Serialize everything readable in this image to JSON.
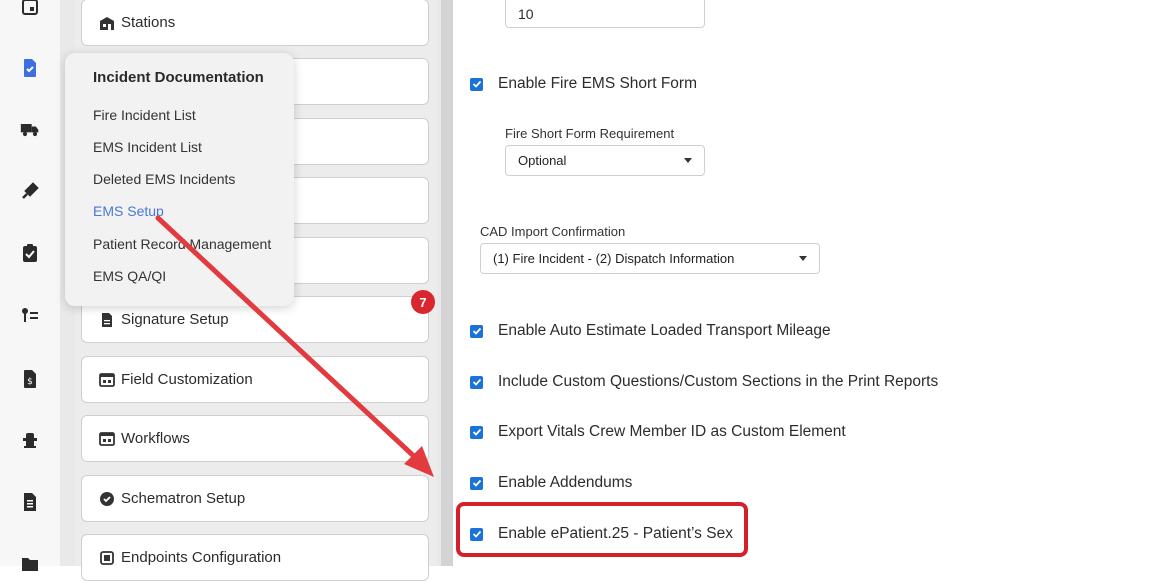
{
  "rail": {
    "icons": [
      "calendar-icon",
      "document-check-icon",
      "truck-icon",
      "syringe-icon",
      "clipboard-check-icon",
      "key-list-icon",
      "invoice-icon",
      "hydrant-icon",
      "report-icon",
      "folder-icon"
    ]
  },
  "settings_list": {
    "items": [
      {
        "label": "Stations",
        "icon": "building-icon"
      },
      {
        "label": "Signature Setup",
        "icon": "file-icon"
      },
      {
        "label": "Field Customization",
        "icon": "form-icon"
      },
      {
        "label": "Workflows",
        "icon": "form-icon"
      },
      {
        "label": "Schematron Setup",
        "icon": "badge-check-icon"
      },
      {
        "label": "Endpoints Configuration",
        "icon": "endpoint-icon"
      }
    ],
    "badge_count": "7"
  },
  "popup": {
    "title": "Incident Documentation",
    "items": [
      {
        "label": "Fire Incident List"
      },
      {
        "label": "EMS Incident List"
      },
      {
        "label": "Deleted EMS Incidents"
      },
      {
        "label": "EMS Setup",
        "active": true
      },
      {
        "label": "Patient Record Management"
      },
      {
        "label": "EMS QA/QI"
      }
    ]
  },
  "main": {
    "top_input_value": "10",
    "checkboxes": [
      {
        "label": "Enable Fire EMS Short Form",
        "checked": true
      },
      {
        "label": "Enable Auto Estimate Loaded Transport Mileage",
        "checked": true
      },
      {
        "label": "Include Custom Questions/Custom Sections in the Print Reports",
        "checked": true
      },
      {
        "label": "Export Vitals Crew Member ID as Custom Element",
        "checked": true
      },
      {
        "label": "Enable Addendums",
        "checked": true
      },
      {
        "label": "Enable ePatient.25 - Patient’s Sex",
        "checked": true
      }
    ],
    "fire_short_form": {
      "label": "Fire Short Form Requirement",
      "value": "Optional"
    },
    "cad_import": {
      "label": "CAD Import Confirmation",
      "value": "(1) Fire Incident - (2) Dispatch Information"
    }
  },
  "colors": {
    "accent": "#1a73d9",
    "annotation_red": "#d42029",
    "link_blue": "#4a78d6",
    "badge_red": "#d9262f"
  }
}
